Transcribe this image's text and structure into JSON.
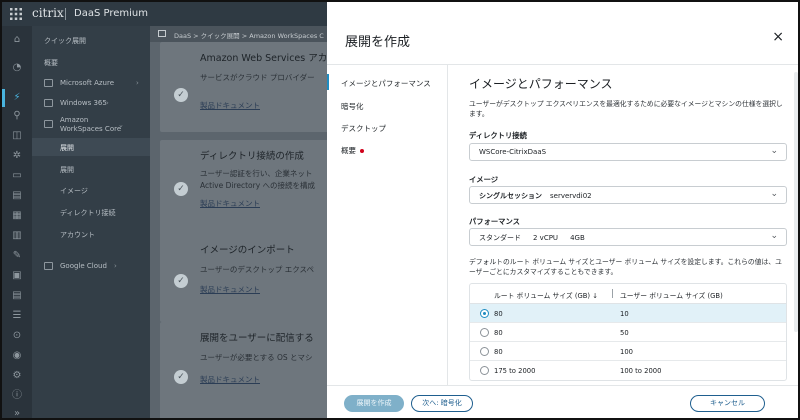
{
  "topbar": {
    "logo": "citrix",
    "product": "DaaS Premium"
  },
  "nav": {
    "quick_deploy": "クイック展開",
    "overview": "概要",
    "azure": "Microsoft Azure",
    "windows365": "Windows 365",
    "aws_line1": "Amazon",
    "aws_line2": "WorkSpaces Core",
    "deploy": "展開",
    "catalog": "展開",
    "image": "イメージ",
    "directory": "ディレクトリ接続",
    "account": "アカウント",
    "google": "Google Cloud"
  },
  "background": {
    "breadcrumb": "DaaS  >  クイック展開  >  Amazon WorkSpaces C",
    "cards": [
      {
        "title": "Amazon Web Services アカウ",
        "desc1": "サービスがクラウド プロバイダー",
        "link": "製品ドキュメント"
      },
      {
        "title": "ディレクトリ接続の作成",
        "desc1": "ユーザー認証を行い、企業ネット",
        "desc2": "Active Directory への接続を構成",
        "link": "製品ドキュメント"
      },
      {
        "title": "イメージのインポート",
        "desc1": "ユーザーのデスクトップ エクスペ",
        "link": "製品ドキュメント"
      },
      {
        "title": "展開をユーザーに配信する",
        "desc1": "ユーザーが必要とする OS とマシ",
        "link": "製品ドキュメント"
      }
    ]
  },
  "modal": {
    "title": "展開を作成",
    "close": "×",
    "steps": [
      "イメージとパフォーマンス",
      "暗号化",
      "デスクトップ",
      "概要"
    ],
    "heading": "イメージとパフォーマンス",
    "description": "ユーザーがデスクトップ エクスペリエンスを最適化するために必要なイメージとマシンの仕様を選択します。",
    "directory_label": "ディレクトリ接続",
    "directory_value": "WSCore-CitrixDaaS",
    "image_label": "イメージ",
    "image_type": "シングルセッション",
    "image_value": "servervdi02",
    "performance_label": "パフォーマンス",
    "perf_tier": "スタンダード",
    "perf_cpu": "2 vCPU",
    "perf_mem": "4GB",
    "volume_note": "デフォルトのルート ボリューム サイズとユーザー ボリューム サイズを設定します。これらの値は、ユーザーごとにカスタマイズすることもできます。",
    "table": {
      "col1": "ルート ボリューム サイズ (GB) ↓",
      "col2": "ユーザー ボリューム サイズ (GB)",
      "rows": [
        {
          "root": "80",
          "user": "10",
          "selected": true
        },
        {
          "root": "80",
          "user": "50",
          "selected": false
        },
        {
          "root": "80",
          "user": "100",
          "selected": false
        },
        {
          "root": "175 to 2000",
          "user": "100 to 2000",
          "selected": false
        }
      ]
    },
    "btn_create": "展開を作成",
    "btn_next": "次へ: 暗号化",
    "btn_cancel": "キャンセル"
  },
  "colors": {
    "accent": "#1f8cc1",
    "primary_disabled": "#7fb0c9",
    "required_dot": "#d0021b"
  }
}
